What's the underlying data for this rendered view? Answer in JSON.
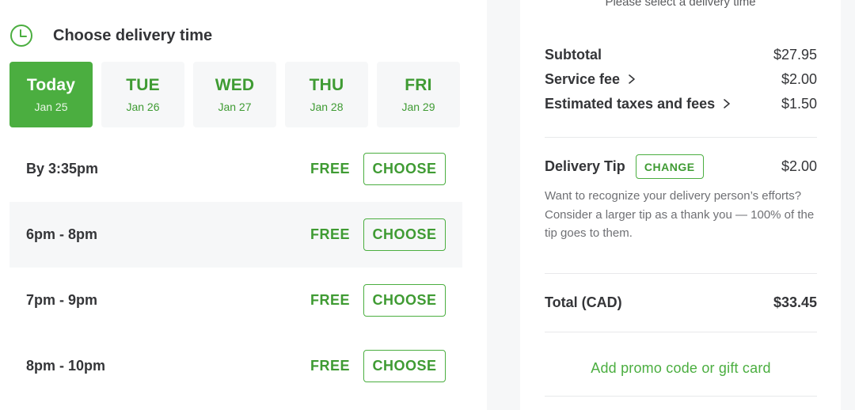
{
  "delivery": {
    "title": "Choose delivery time",
    "days": [
      {
        "name": "Today",
        "date": "Jan 25",
        "selected": true
      },
      {
        "name": "TUE",
        "date": "Jan 26",
        "selected": false
      },
      {
        "name": "WED",
        "date": "Jan 27",
        "selected": false
      },
      {
        "name": "THU",
        "date": "Jan 28",
        "selected": false
      },
      {
        "name": "FRI",
        "date": "Jan 29",
        "selected": false
      }
    ],
    "slots": [
      {
        "time": "By 3:35pm",
        "price": "FREE",
        "button": "CHOOSE"
      },
      {
        "time": "6pm - 8pm",
        "price": "FREE",
        "button": "CHOOSE"
      },
      {
        "time": "7pm - 9pm",
        "price": "FREE",
        "button": "CHOOSE"
      },
      {
        "time": "8pm - 10pm",
        "price": "FREE",
        "button": "CHOOSE"
      }
    ]
  },
  "summary": {
    "notice": "Please select a delivery time",
    "subtotal": {
      "label": "Subtotal",
      "value": "$27.95"
    },
    "service_fee": {
      "label": "Service fee",
      "value": "$2.00"
    },
    "taxes": {
      "label": "Estimated taxes and fees",
      "value": "$1.50"
    },
    "tip": {
      "label": "Delivery Tip",
      "change_label": "CHANGE",
      "value": "$2.00",
      "description": "Want to recognize your delivery person’s efforts? Consider a larger tip as a thank you — 100% of the tip goes to them."
    },
    "total": {
      "label": "Total (CAD)",
      "value": "$33.45"
    },
    "promo": "Add promo code or gift card"
  },
  "colors": {
    "accent_green": "#4bae40",
    "text_green": "#3f9b33",
    "text_dark": "#343538",
    "muted_bg": "#f6f7f8"
  },
  "icons": {
    "header": "clock-icon",
    "row_disclosure": "chevron-right-icon"
  }
}
